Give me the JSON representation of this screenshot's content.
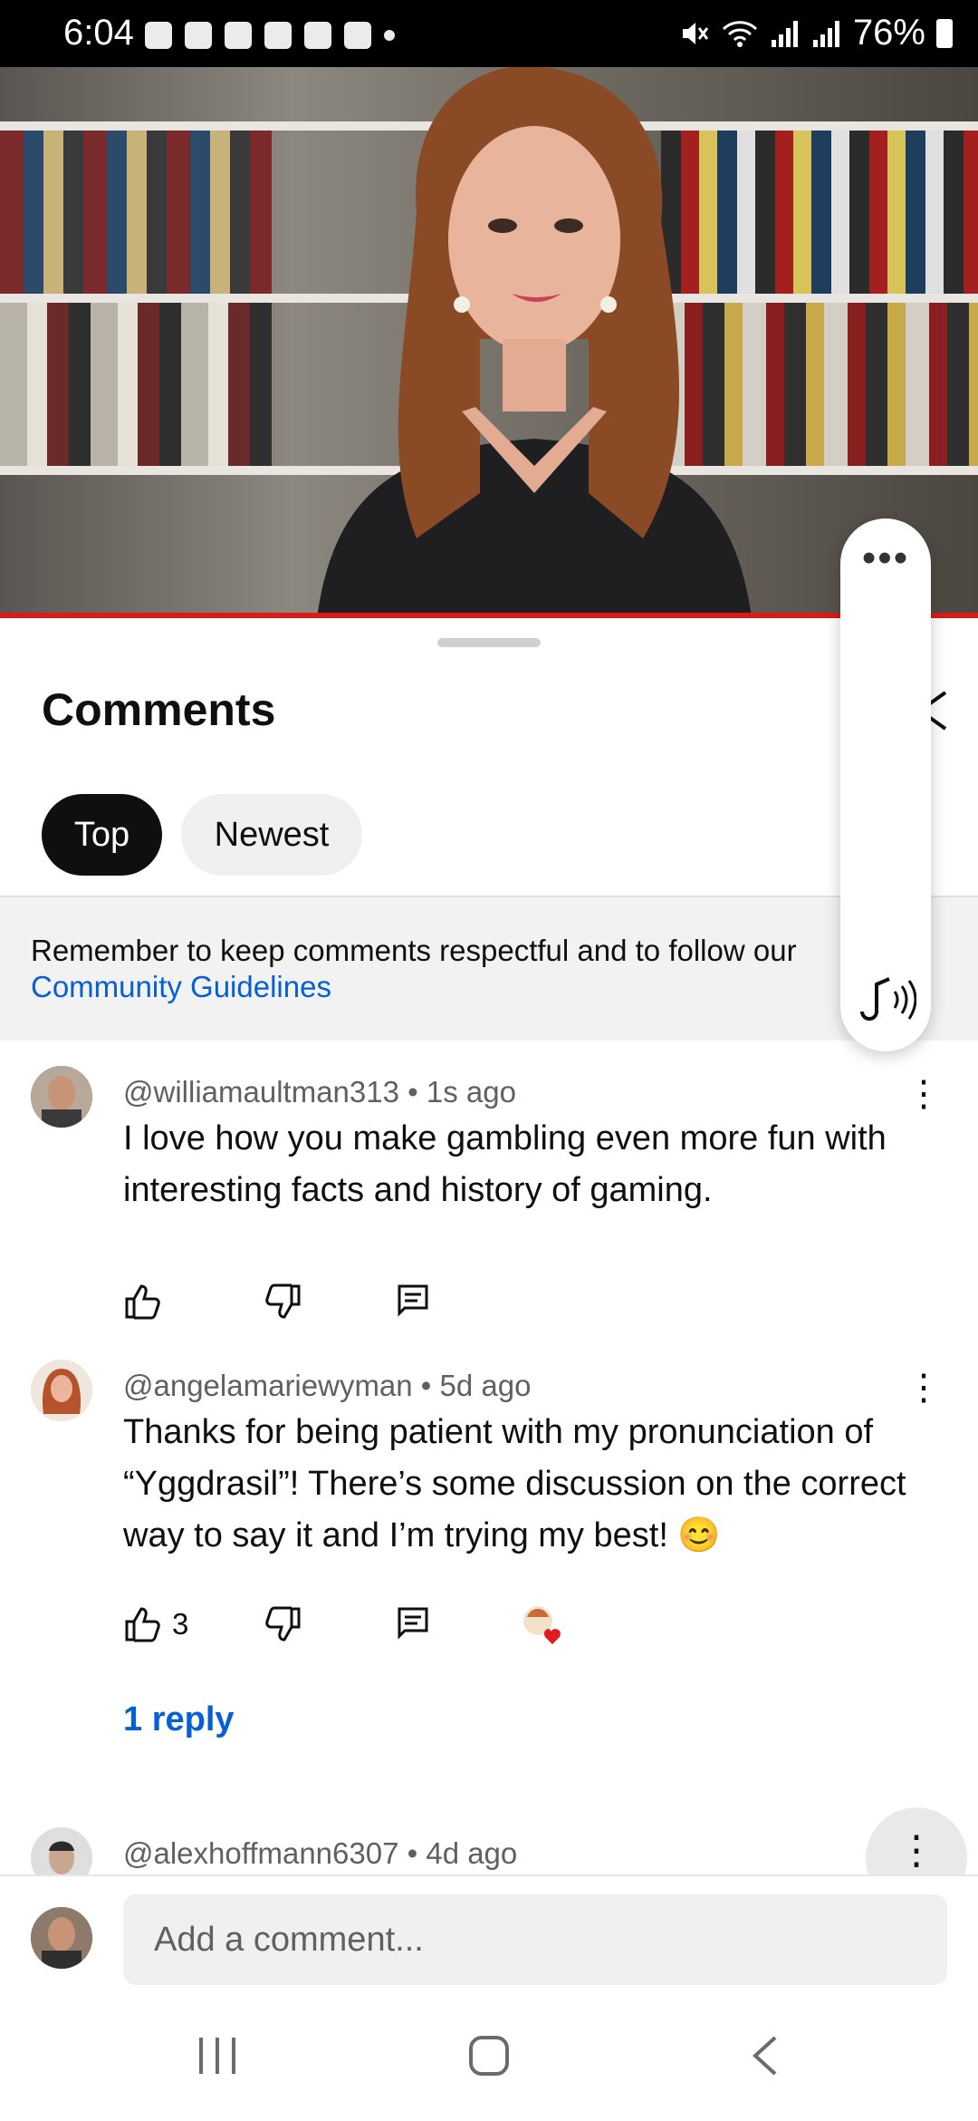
{
  "status_bar": {
    "time": "6:04",
    "battery": "76%"
  },
  "sheet": {
    "title": "Comments",
    "filters": [
      {
        "label": "Top",
        "selected": true
      },
      {
        "label": "Newest",
        "selected": false
      }
    ],
    "notice_text": "Remember to keep comments respectful and to follow our",
    "notice_link": "Community Guidelines"
  },
  "comments": [
    {
      "author": "@williamaultman313 • 1s ago",
      "text": "I love how you make gambling even more fun with interesting facts and history of gaming.",
      "likes": ""
    },
    {
      "author": "@angelamariewyman • 5d ago",
      "text": "Thanks for being patient with my pronunciation of “Yggdrasil”! There’s some discussion on the correct way to say it and I’m trying my best! 😊",
      "likes": "3",
      "replies": "1 reply"
    },
    {
      "author": "@alexhoffmann6307 • 4d ago"
    }
  ],
  "composer": {
    "placeholder": "Add a comment..."
  },
  "colors": {
    "accent_link": "#065fd4",
    "progress": "#d81b1b",
    "chip_selected": "#0f0f0f"
  }
}
